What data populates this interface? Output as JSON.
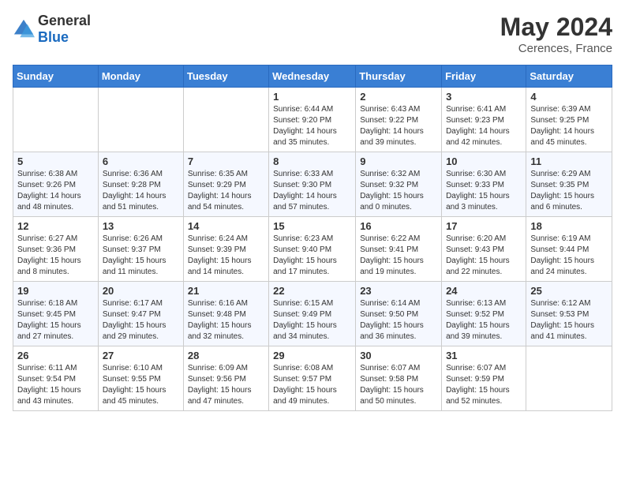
{
  "header": {
    "logo_general": "General",
    "logo_blue": "Blue",
    "month": "May 2024",
    "location": "Cerences, France"
  },
  "days_of_week": [
    "Sunday",
    "Monday",
    "Tuesday",
    "Wednesday",
    "Thursday",
    "Friday",
    "Saturday"
  ],
  "weeks": [
    [
      {
        "day": "",
        "sunrise": "",
        "sunset": "",
        "daylight": ""
      },
      {
        "day": "",
        "sunrise": "",
        "sunset": "",
        "daylight": ""
      },
      {
        "day": "",
        "sunrise": "",
        "sunset": "",
        "daylight": ""
      },
      {
        "day": "1",
        "sunrise": "6:44 AM",
        "sunset": "9:20 PM",
        "daylight": "14 hours and 35 minutes."
      },
      {
        "day": "2",
        "sunrise": "6:43 AM",
        "sunset": "9:22 PM",
        "daylight": "14 hours and 39 minutes."
      },
      {
        "day": "3",
        "sunrise": "6:41 AM",
        "sunset": "9:23 PM",
        "daylight": "14 hours and 42 minutes."
      },
      {
        "day": "4",
        "sunrise": "6:39 AM",
        "sunset": "9:25 PM",
        "daylight": "14 hours and 45 minutes."
      }
    ],
    [
      {
        "day": "5",
        "sunrise": "6:38 AM",
        "sunset": "9:26 PM",
        "daylight": "14 hours and 48 minutes."
      },
      {
        "day": "6",
        "sunrise": "6:36 AM",
        "sunset": "9:28 PM",
        "daylight": "14 hours and 51 minutes."
      },
      {
        "day": "7",
        "sunrise": "6:35 AM",
        "sunset": "9:29 PM",
        "daylight": "14 hours and 54 minutes."
      },
      {
        "day": "8",
        "sunrise": "6:33 AM",
        "sunset": "9:30 PM",
        "daylight": "14 hours and 57 minutes."
      },
      {
        "day": "9",
        "sunrise": "6:32 AM",
        "sunset": "9:32 PM",
        "daylight": "15 hours and 0 minutes."
      },
      {
        "day": "10",
        "sunrise": "6:30 AM",
        "sunset": "9:33 PM",
        "daylight": "15 hours and 3 minutes."
      },
      {
        "day": "11",
        "sunrise": "6:29 AM",
        "sunset": "9:35 PM",
        "daylight": "15 hours and 6 minutes."
      }
    ],
    [
      {
        "day": "12",
        "sunrise": "6:27 AM",
        "sunset": "9:36 PM",
        "daylight": "15 hours and 8 minutes."
      },
      {
        "day": "13",
        "sunrise": "6:26 AM",
        "sunset": "9:37 PM",
        "daylight": "15 hours and 11 minutes."
      },
      {
        "day": "14",
        "sunrise": "6:24 AM",
        "sunset": "9:39 PM",
        "daylight": "15 hours and 14 minutes."
      },
      {
        "day": "15",
        "sunrise": "6:23 AM",
        "sunset": "9:40 PM",
        "daylight": "15 hours and 17 minutes."
      },
      {
        "day": "16",
        "sunrise": "6:22 AM",
        "sunset": "9:41 PM",
        "daylight": "15 hours and 19 minutes."
      },
      {
        "day": "17",
        "sunrise": "6:20 AM",
        "sunset": "9:43 PM",
        "daylight": "15 hours and 22 minutes."
      },
      {
        "day": "18",
        "sunrise": "6:19 AM",
        "sunset": "9:44 PM",
        "daylight": "15 hours and 24 minutes."
      }
    ],
    [
      {
        "day": "19",
        "sunrise": "6:18 AM",
        "sunset": "9:45 PM",
        "daylight": "15 hours and 27 minutes."
      },
      {
        "day": "20",
        "sunrise": "6:17 AM",
        "sunset": "9:47 PM",
        "daylight": "15 hours and 29 minutes."
      },
      {
        "day": "21",
        "sunrise": "6:16 AM",
        "sunset": "9:48 PM",
        "daylight": "15 hours and 32 minutes."
      },
      {
        "day": "22",
        "sunrise": "6:15 AM",
        "sunset": "9:49 PM",
        "daylight": "15 hours and 34 minutes."
      },
      {
        "day": "23",
        "sunrise": "6:14 AM",
        "sunset": "9:50 PM",
        "daylight": "15 hours and 36 minutes."
      },
      {
        "day": "24",
        "sunrise": "6:13 AM",
        "sunset": "9:52 PM",
        "daylight": "15 hours and 39 minutes."
      },
      {
        "day": "25",
        "sunrise": "6:12 AM",
        "sunset": "9:53 PM",
        "daylight": "15 hours and 41 minutes."
      }
    ],
    [
      {
        "day": "26",
        "sunrise": "6:11 AM",
        "sunset": "9:54 PM",
        "daylight": "15 hours and 43 minutes."
      },
      {
        "day": "27",
        "sunrise": "6:10 AM",
        "sunset": "9:55 PM",
        "daylight": "15 hours and 45 minutes."
      },
      {
        "day": "28",
        "sunrise": "6:09 AM",
        "sunset": "9:56 PM",
        "daylight": "15 hours and 47 minutes."
      },
      {
        "day": "29",
        "sunrise": "6:08 AM",
        "sunset": "9:57 PM",
        "daylight": "15 hours and 49 minutes."
      },
      {
        "day": "30",
        "sunrise": "6:07 AM",
        "sunset": "9:58 PM",
        "daylight": "15 hours and 50 minutes."
      },
      {
        "day": "31",
        "sunrise": "6:07 AM",
        "sunset": "9:59 PM",
        "daylight": "15 hours and 52 minutes."
      },
      {
        "day": "",
        "sunrise": "",
        "sunset": "",
        "daylight": ""
      }
    ]
  ]
}
